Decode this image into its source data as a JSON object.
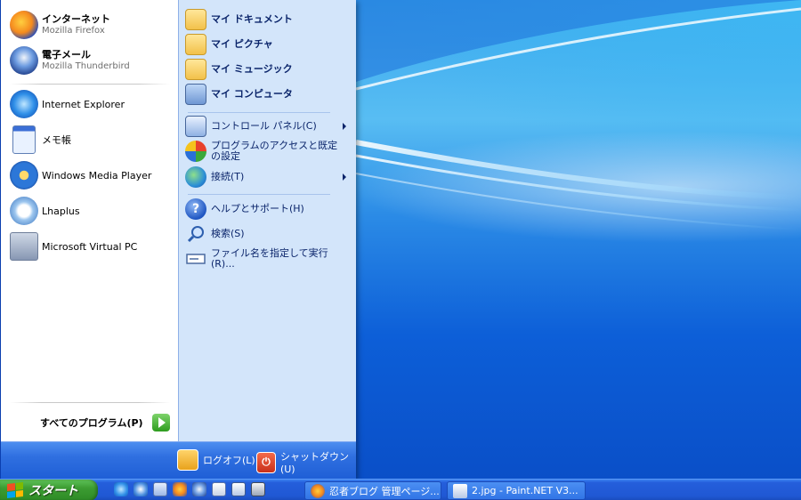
{
  "colors": {
    "menu_blue": "#2a67dc",
    "right_pane": "#d3e5fa",
    "start_green": "#3c9c32",
    "taskbar_blue": "#245edb"
  },
  "start_menu": {
    "pinned": [
      {
        "title": "インターネット",
        "subtitle": "Mozilla Firefox",
        "icon": "firefox-icon"
      },
      {
        "title": "電子メール",
        "subtitle": "Mozilla Thunderbird",
        "icon": "thunderbird-icon"
      }
    ],
    "recent": [
      {
        "label": "Internet Explorer",
        "icon": "internet-explorer-icon"
      },
      {
        "label": "メモ帳",
        "icon": "notepad-icon"
      },
      {
        "label": "Windows Media Player",
        "icon": "media-player-icon"
      },
      {
        "label": "Lhaplus",
        "icon": "lhaplus-icon"
      },
      {
        "label": "Microsoft Virtual PC",
        "icon": "virtual-pc-icon"
      }
    ],
    "all_programs": "すべてのプログラム(P)",
    "right": {
      "documents": "マイ ドキュメント",
      "pictures": "マイ ピクチャ",
      "music": "マイ ミュージック",
      "computer": "マイ コンピュータ",
      "control_panel": "コントロール パネル(C)",
      "program_access": "プログラムのアクセスと既定の設定",
      "connect": "接続(T)",
      "help": "ヘルプとサポート(H)",
      "search": "検索(S)",
      "run": "ファイル名を指定して実行(R)..."
    },
    "logoff": "ログオフ(L)",
    "shutdown": "シャットダウン(U)"
  },
  "taskbar": {
    "start_label": "スタート",
    "tasks": [
      {
        "label": "忍者ブログ 管理ページ..."
      },
      {
        "label": "2.jpg - Paint.NET V3..."
      }
    ]
  }
}
